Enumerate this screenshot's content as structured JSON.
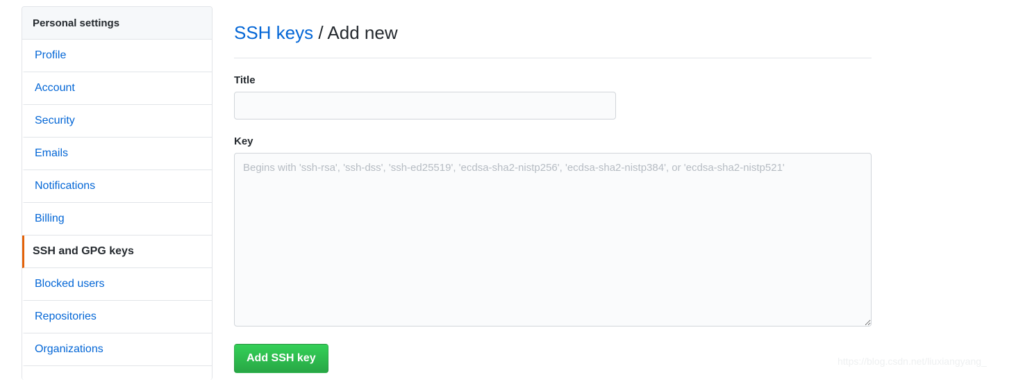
{
  "sidebar": {
    "header": "Personal settings",
    "items": [
      {
        "label": "Profile",
        "selected": false
      },
      {
        "label": "Account",
        "selected": false
      },
      {
        "label": "Security",
        "selected": false
      },
      {
        "label": "Emails",
        "selected": false
      },
      {
        "label": "Notifications",
        "selected": false
      },
      {
        "label": "Billing",
        "selected": false
      },
      {
        "label": "SSH and GPG keys",
        "selected": true
      },
      {
        "label": "Blocked users",
        "selected": false
      },
      {
        "label": "Repositories",
        "selected": false
      },
      {
        "label": "Organizations",
        "selected": false
      }
    ]
  },
  "header": {
    "link_text": "SSH keys",
    "separator": "/",
    "current": "Add new"
  },
  "form": {
    "title_label": "Title",
    "title_value": "",
    "title_placeholder": "",
    "key_label": "Key",
    "key_value": "",
    "key_placeholder": "Begins with 'ssh-rsa', 'ssh-dss', 'ssh-ed25519', 'ecdsa-sha2-nistp256', 'ecdsa-sha2-nistp384', or 'ecdsa-sha2-nistp521'",
    "submit_label": "Add SSH key"
  },
  "watermark": {
    "text": "https://blog.csdn.net/liuxiangyang_"
  },
  "colors": {
    "link": "#0366d6",
    "selected_accent": "#e36209",
    "submit_green": "#2cbe4e",
    "panel_header_bg": "#f6f8fa",
    "border": "#e1e4e8"
  }
}
